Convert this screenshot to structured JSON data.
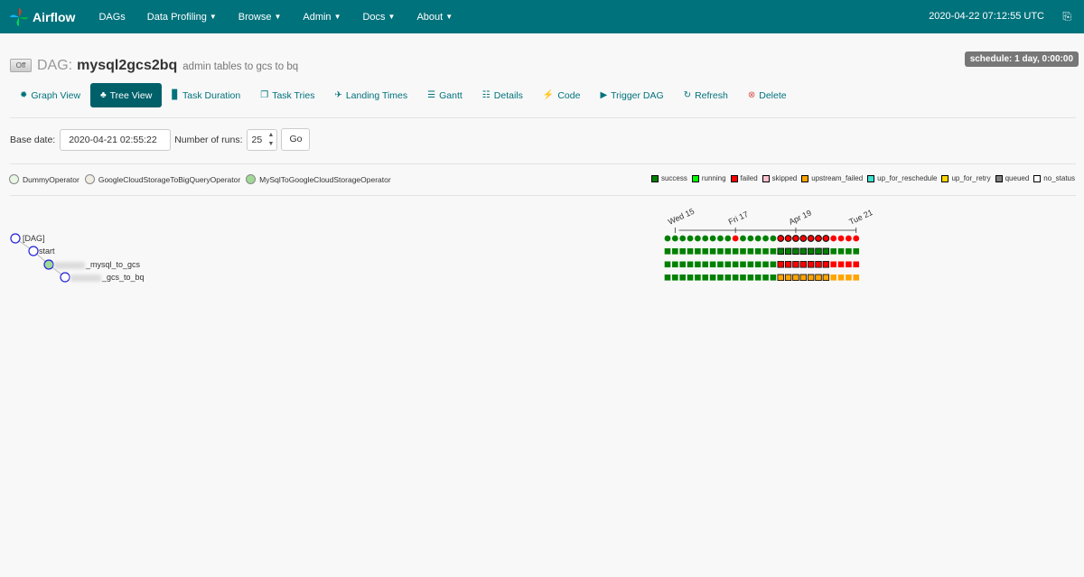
{
  "navbar": {
    "brand": "Airflow",
    "items": [
      {
        "label": "DAGs",
        "dropdown": false
      },
      {
        "label": "Data Profiling",
        "dropdown": true
      },
      {
        "label": "Browse",
        "dropdown": true
      },
      {
        "label": "Admin",
        "dropdown": true
      },
      {
        "label": "Docs",
        "dropdown": true
      },
      {
        "label": "About",
        "dropdown": true
      }
    ],
    "datetime": "2020-04-22 07:12:55 UTC",
    "logout_icon": "logout-icon"
  },
  "dag": {
    "toggle": "Off",
    "label": "DAG:",
    "id": "mysql2gcs2bq",
    "description": "admin tables to gcs to bq",
    "schedule": "schedule: 1 day, 0:00:00"
  },
  "tabs": [
    {
      "label": "Graph View",
      "icon": "✹",
      "active": false
    },
    {
      "label": "Tree View",
      "icon": "♣",
      "active": true
    },
    {
      "label": "Task Duration",
      "icon": "▊",
      "active": false
    },
    {
      "label": "Task Tries",
      "icon": "❐",
      "active": false
    },
    {
      "label": "Landing Times",
      "icon": "✈",
      "active": false
    },
    {
      "label": "Gantt",
      "icon": "☰",
      "active": false
    },
    {
      "label": "Details",
      "icon": "☷",
      "active": false
    },
    {
      "label": "Code",
      "icon": "⚡",
      "active": false
    },
    {
      "label": "Trigger DAG",
      "icon": "▶",
      "active": false
    },
    {
      "label": "Refresh",
      "icon": "↻",
      "active": false
    },
    {
      "label": "Delete",
      "icon": "⊗",
      "active": false
    }
  ],
  "form": {
    "base_date_label": "Base date:",
    "base_date_value": "2020-04-21 02:55:22",
    "runs_label": "Number of runs:",
    "runs_value": "25",
    "go_label": "Go"
  },
  "operators": [
    {
      "label": "DummyOperator",
      "color": "#e8f7e4"
    },
    {
      "label": "GoogleCloudStorageToBigQueryOperator",
      "color": "#f0ede4"
    },
    {
      "label": "MySqlToGoogleCloudStorageOperator",
      "color": "#a0d995"
    }
  ],
  "states": [
    {
      "label": "success",
      "color": "#008000"
    },
    {
      "label": "running",
      "color": "#00ff00"
    },
    {
      "label": "failed",
      "color": "#ff0000"
    },
    {
      "label": "skipped",
      "color": "#ffc0cb"
    },
    {
      "label": "upstream_failed",
      "color": "#ffa500"
    },
    {
      "label": "up_for_reschedule",
      "color": "#40e0d0"
    },
    {
      "label": "up_for_retry",
      "color": "#ffd700"
    },
    {
      "label": "queued",
      "color": "#808080"
    },
    {
      "label": "no_status",
      "color": "#ffffff"
    }
  ],
  "tree": {
    "nodes": [
      {
        "label": "[DAG]",
        "depth": 0,
        "blurred": false
      },
      {
        "label": "start",
        "depth": 1,
        "blurred": false
      },
      {
        "label": "_mysql_to_gcs",
        "depth": 2,
        "blurred": true
      },
      {
        "label": "_gcs_to_bq",
        "depth": 3,
        "blurred": true
      }
    ]
  },
  "grid": {
    "date_ticks": [
      {
        "label": "Wed 15",
        "run": 1
      },
      {
        "label": "Fri 17",
        "run": 9
      },
      {
        "label": "Apr 19",
        "run": 17
      },
      {
        "label": "Tue 21",
        "run": 25
      }
    ],
    "runs": 26,
    "dag_runs": [
      "success",
      "success",
      "success",
      "success",
      "success",
      "success",
      "success",
      "success",
      "success",
      "failed",
      "success",
      "success",
      "success",
      "success",
      "success",
      "failed",
      "failed",
      "failed",
      "failed",
      "failed",
      "failed",
      "failed",
      "failed",
      "failed",
      "failed",
      "failed"
    ],
    "task_rows": [
      [
        "success",
        "success",
        "success",
        "success",
        "success",
        "success",
        "success",
        "success",
        "success",
        "success",
        "success",
        "success",
        "success",
        "success",
        "success",
        "success",
        "success",
        "success",
        "success",
        "success",
        "success",
        "success",
        "success",
        "success",
        "success",
        "success"
      ],
      [
        "success",
        "success",
        "success",
        "success",
        "success",
        "success",
        "success",
        "success",
        "success",
        "success",
        "success",
        "success",
        "success",
        "success",
        "success",
        "failed",
        "failed",
        "failed",
        "failed",
        "failed",
        "failed",
        "failed",
        "failed",
        "failed",
        "failed",
        "failed"
      ],
      [
        "success",
        "success",
        "success",
        "success",
        "success",
        "success",
        "success",
        "success",
        "success",
        "success",
        "success",
        "success",
        "success",
        "success",
        "success",
        "upstream_failed",
        "upstream_failed",
        "upstream_failed",
        "upstream_failed",
        "upstream_failed",
        "upstream_failed",
        "upstream_failed",
        "upstream_failed",
        "upstream_failed",
        "upstream_failed",
        "upstream_failed"
      ]
    ],
    "highlight_start": 15,
    "highlight_end": 21
  }
}
